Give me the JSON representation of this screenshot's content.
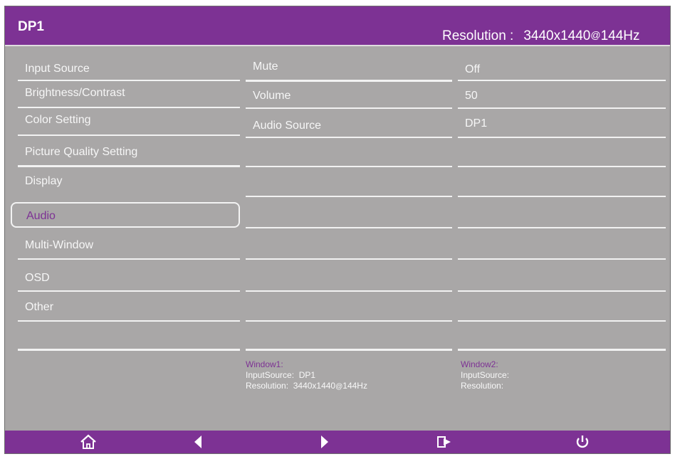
{
  "header": {
    "title": "DP1",
    "resolution_label": "Resolution :",
    "resolution_value_pre": "3440x1440",
    "resolution_at": "@",
    "resolution_value_post": "144Hz"
  },
  "menu": {
    "items": [
      {
        "label": "Input Source"
      },
      {
        "label": "Brightness/Contrast"
      },
      {
        "label": "Color Setting"
      },
      {
        "label": "Picture Quality Setting"
      },
      {
        "label": "Display"
      },
      {
        "label": "Audio",
        "selected": true
      },
      {
        "label": "Multi-Window"
      },
      {
        "label": "OSD"
      },
      {
        "label": "Other"
      }
    ]
  },
  "submenu": {
    "items": [
      {
        "label": "Mute",
        "value": "Off"
      },
      {
        "label": "Volume",
        "value": "50"
      },
      {
        "label": "Audio Source",
        "value": "DP1"
      }
    ]
  },
  "window1": {
    "title": "Window1:",
    "input_label": "InputSource:",
    "input_value": "DP1",
    "res_label": "Resolution:",
    "res_pre": "3440x1440",
    "res_at": "@",
    "res_post": "144Hz"
  },
  "window2": {
    "title": "Window2:",
    "input_label": "InputSource:",
    "res_label": "Resolution:"
  },
  "footer": {
    "icons": [
      "home-icon",
      "left-arrow-icon",
      "right-arrow-icon",
      "exit-icon",
      "power-icon"
    ]
  },
  "colors": {
    "accent": "#7d3294",
    "panel": "#a9a7a7",
    "text": "#ffffff"
  }
}
